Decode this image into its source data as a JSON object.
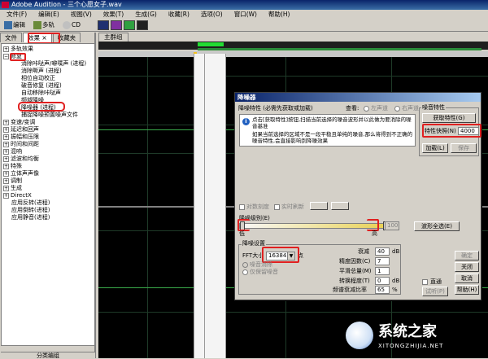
{
  "window": {
    "title": "Adobe Audition - 三个心愿女子.wav"
  },
  "menu": [
    "文件(F)",
    "编辑(E)",
    "视图(V)",
    "效果(T)",
    "生成(G)",
    "收藏(R)",
    "选项(O)",
    "窗口(W)",
    "帮助(H)"
  ],
  "toolbar": {
    "edit_label": "编辑",
    "multitrack_label": "多轨",
    "cd_label": "CD"
  },
  "left_panel": {
    "tabs": [
      "文件",
      "效果 ×",
      "收藏夹"
    ],
    "tree": [
      "多轨效果",
      "修复",
      "消除咔哒声/噼噗声 (进程)",
      "消除嘶声 (进程)",
      "相位自动校正",
      "破音修复 (进程)",
      "自动移除咔哒声",
      "频域降噪",
      "降噪器 (进程)",
      "捕捉降噪预置噪声文件",
      "变速/变调",
      "延迟和回声",
      "振幅和压限",
      "时间和间距",
      "混响",
      "滤波和均衡",
      "特殊",
      "立体声声像",
      "调制",
      "生成",
      "DirectX",
      "应用反转(进程)",
      "应用倒转(进程)",
      "应用静音(进程)"
    ],
    "bottom_label": "分类编组"
  },
  "main": {
    "tab_label": "主群组"
  },
  "dialog": {
    "title": "降噪器",
    "profile_label": "降噪特性 (必需先获取或加载)",
    "view_label": "查看:",
    "left_channel": "左声道",
    "right_channel": "右声道",
    "info_line1": "点击[获取特性]按钮,扫描当前选择的噪音波形并以此做为要消除的噪音基准",
    "info_line2": "如果当前选择的区域不是一段平稳且单纯的噪音,那么将得到不正确的噪音特性,会直接影响到降噪效果",
    "group_profile": "噪音特性",
    "btn_capture": "获取特性(G)",
    "snapshots_label": "特性快照(N)",
    "snapshots_value": "4000",
    "btn_load": "加载(L)",
    "btn_save": "保存",
    "log_scale": "对数刻度",
    "live_update": "实时刷新",
    "level_label": "降噪级别(E)",
    "level_value": "100",
    "low_label": "低",
    "high_label": "高",
    "btn_select_all": "波形全选(E)",
    "group_settings": "降噪设置",
    "fft_label": "FFT大小",
    "fft_value": "16384",
    "fft_unit": "点",
    "remove_noise": "噪音消除",
    "keep_noise": "仅保留噪音",
    "reduce_by_label": "衰减",
    "reduce_by_value": "40",
    "reduce_by_unit": "dB",
    "precision_label": "精度因数(C)",
    "precision_value": "7",
    "smoothing_label": "平滑总量(M)",
    "smoothing_value": "1",
    "transition_label": "转换程度(T)",
    "transition_value": "0",
    "transition_unit": "dB",
    "spectral_label": "频谱衰减比率",
    "spectral_value": "65",
    "spectral_unit": "%",
    "btn_ok": "确定",
    "btn_close": "关闭",
    "btn_cancel": "取消",
    "btn_help": "帮助(H)",
    "bypass_label": "直通",
    "btn_preview": "试听(P)"
  },
  "watermark": {
    "title": "系统之家",
    "url": "XITONGZHIJIA.NET"
  }
}
